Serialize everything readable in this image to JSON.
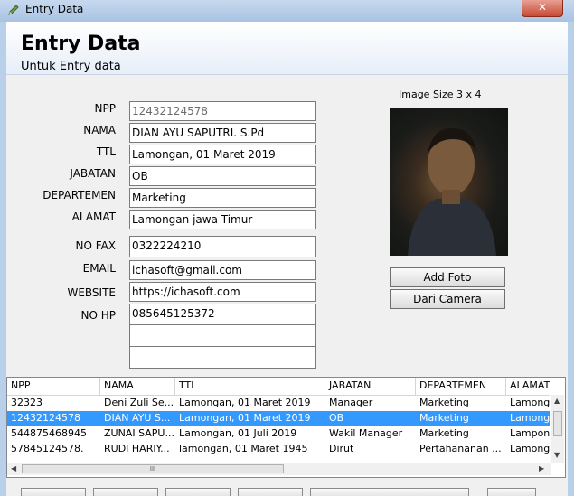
{
  "window": {
    "title": "Entry Data",
    "close_label": "✕"
  },
  "header": {
    "title": "Entry Data",
    "subtitle": "Untuk Entry data"
  },
  "form": {
    "labels": {
      "npp": "NPP",
      "nama": "NAMA",
      "ttl": "TTL",
      "jabatan": "JABATAN",
      "departemen": "DEPARTEMEN",
      "alamat": "ALAMAT",
      "no_fax": "NO FAX",
      "email": "EMAIL",
      "website": "WEBSITE",
      "no_hp": "NO HP"
    },
    "values": {
      "npp": "12432124578",
      "nama": "DIAN AYU SAPUTRI. S.Pd",
      "ttl": "Lamongan, 01 Maret 2019",
      "jabatan": "OB",
      "departemen": "Marketing",
      "alamat": "Lamongan jawa Timur",
      "no_fax": "0322224210",
      "email": "ichasoft@gmail.com",
      "website": "https://ichasoft.com",
      "no_hp": "085645125372"
    }
  },
  "photo": {
    "size_label": "Image Size 3 x 4"
  },
  "buttons": {
    "add_photo": "Add Foto",
    "from_camera": "Dari Camera"
  },
  "grid": {
    "columns": [
      "NPP",
      "NAMA",
      "TTL",
      "JABATAN",
      "DEPARTEMEN",
      "ALAMAT"
    ],
    "rows": [
      [
        "32323",
        "Deni Zuli Se...",
        "Lamongan, 01 Maret 2019",
        "Manager",
        "Marketing",
        "Lamonga"
      ],
      [
        "12432124578",
        "DIAN AYU S...",
        "Lamongan, 01 Maret 2019",
        "OB",
        "Marketing",
        "Lamonga"
      ],
      [
        "544875468945",
        "ZUNAI SAPU...",
        "Lamongan, 01 Juli 2019",
        "Wakil Manager",
        "Marketing",
        "Lampong"
      ],
      [
        "57845124578.",
        "RUDI HARIY...",
        "lamongan, 01 Maret 1945",
        "Dirut",
        "Pertahananan ...",
        "Lamonga"
      ]
    ],
    "selected_index": 1,
    "hscroll_grip": "III"
  }
}
